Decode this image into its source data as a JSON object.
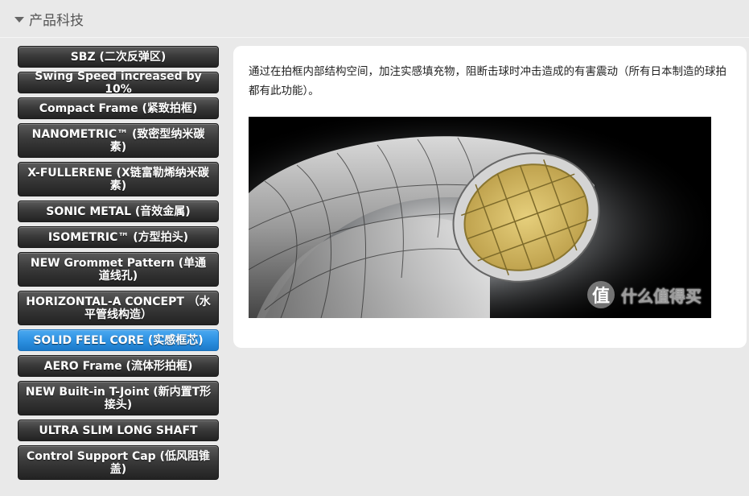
{
  "section": {
    "title": "产品科技"
  },
  "menu": {
    "items": [
      {
        "label": "SBZ (二次反弹区)",
        "rows": 1,
        "active": false
      },
      {
        "label": "Swing Speed increased by 10%",
        "rows": 1,
        "active": false
      },
      {
        "label": "Compact Frame (紧致拍框)",
        "rows": 1,
        "active": false
      },
      {
        "label": "NANOMETRIC™ (致密型纳米碳素)",
        "rows": 2,
        "active": false
      },
      {
        "label": "X-FULLERENE (X链富勒烯纳米碳素)",
        "rows": 2,
        "active": false
      },
      {
        "label": "SONIC METAL (音效金属)",
        "rows": 1,
        "active": false
      },
      {
        "label": "ISOMETRIC™ (方型拍头)",
        "rows": 1,
        "active": false
      },
      {
        "label": "NEW Grommet Pattern (单通道线孔)",
        "rows": 2,
        "active": false
      },
      {
        "label": "HORIZONTAL-A CONCEPT （水平管线构造）",
        "rows": 2,
        "active": false
      },
      {
        "label": "SOLID FEEL CORE (实感框芯)",
        "rows": 1,
        "active": true
      },
      {
        "label": "AERO Frame (流体形拍框)",
        "rows": 1,
        "active": false
      },
      {
        "label": "NEW Built-in T-Joint (新内置T形接头)",
        "rows": 2,
        "active": false
      },
      {
        "label": "ULTRA SLIM LONG SHAFT",
        "rows": 1,
        "active": false
      },
      {
        "label": "Control Support Cap (低风阻锥盖)",
        "rows": 2,
        "active": false
      }
    ]
  },
  "content": {
    "description": "通过在拍框内部结构空间，加注实感填充物，阻断击球时冲击造成的有害震动（所有日本制造的球拍都有此功能）。",
    "image_alt": "frame cross-section illustration"
  },
  "watermark": {
    "icon_text": "值",
    "text": "什么值得买"
  },
  "colors": {
    "active": "#2b8fe0",
    "inactive": "#3a3a3a",
    "core_fill": "#d8c069"
  }
}
